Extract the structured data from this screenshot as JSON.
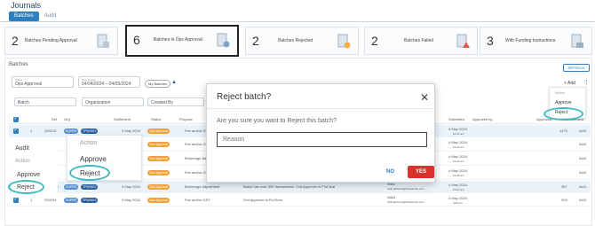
{
  "header": {
    "title": "Journals",
    "tabs": [
      {
        "label": "Batches",
        "active": true
      },
      {
        "label": "Audit",
        "active": false
      }
    ]
  },
  "cards": [
    {
      "count": "2",
      "label": "Batches Pending Approval"
    },
    {
      "count": "6",
      "label": "Batches in Ops Approval"
    },
    {
      "count": "2",
      "label": "Batches Rejected"
    },
    {
      "count": "2",
      "label": "Batches Failed"
    },
    {
      "count": "3",
      "label": "With Funding Instructions"
    }
  ],
  "section": {
    "title": "Batches",
    "refresh": "REFRESH"
  },
  "filters": {
    "status_cap": "Status",
    "status_val": "Ops Approval",
    "date_cap": "Date Range",
    "date_val": "04/04/2024 – 04/05/2024",
    "my_batches": "My Batches",
    "batch_ph": "Batch",
    "org_ph": "Organization",
    "created_ph": "Created By",
    "add": "+ Add"
  },
  "table": {
    "headers": [
      "Ref",
      "Org",
      "Settlement",
      "Status",
      "Purpose",
      "Submitted",
      "Approved by",
      "Approved",
      "Settlement"
    ],
    "rows": [
      {
        "num": "1",
        "ref": "200213",
        "org1": "SUPER",
        "org2": "TPWIDEJ",
        "settle": "4 May 2024",
        "status": "Ops Approval",
        "purpose": "Fee and/or GST",
        "submitted": "4 May 2024",
        "time": "10:23 am",
        "approved": "1475",
        "cur": "AUD"
      },
      {
        "num": "",
        "ref": "",
        "org1": "",
        "org2": "",
        "settle": "4 May 2024",
        "status": "Ops Approval",
        "purpose": "Fee and/or GST",
        "submitted": "4 May 2024",
        "time": "10:23 am",
        "approved": "",
        "cur": "AUD"
      },
      {
        "num": "",
        "ref": "",
        "org1": "",
        "org2": "",
        "settle": "4 May 2024",
        "status": "Ops Approval",
        "purpose": "Brokerage Adjust",
        "submitted": "4 May 2024",
        "time": "10:23 am",
        "approved": "",
        "cur": "AUD"
      },
      {
        "num": "",
        "ref": "",
        "org1": "",
        "org2": "",
        "settle": "4 May 2024",
        "status": "Ops Approval",
        "purpose": "Fee and/or GST",
        "submitted": "4 May 2024",
        "time": "10:45 am",
        "approved": "",
        "cur": "AUD"
      },
      {
        "num": "5",
        "ref": "",
        "org1": "SUPER",
        "org2": "TPWIDEJ",
        "settle": "3 May 2024",
        "status": "Ops Approval",
        "purpose": "Brokerage Adjustment",
        "note": "Batch has over 500 transactions. 2nd Approver is FinClear",
        "user": "Nikki",
        "email": "nikki.gibbons@finclearmfs.com",
        "submitted": "4 May 2024",
        "time": "10:07 am",
        "approved": "357",
        "cur": "AUD"
      },
      {
        "num": "1",
        "ref": "200204",
        "org1": "SUPER",
        "org2": "TPWIDEJ",
        "settle": "3 May 2024",
        "status": "Ops Approval",
        "purpose": "Fee and/or GST",
        "note": "2nd Approver is FinClear",
        "user": "Nikki",
        "email": "nikki.gibbons@finclearmfs.com",
        "submitted": "4 May 2024",
        "time": "4:23 pm",
        "approved": "200",
        "cur": "AUD"
      }
    ]
  },
  "left_panel": {
    "audit": "Audit",
    "action": "Action",
    "approve": "Approve",
    "reject": "Reject"
  },
  "menu_big": {
    "action": "Action",
    "approve": "Approve",
    "reject": "Reject"
  },
  "menu_small": {
    "action": "Action",
    "approve": "Approve",
    "reject": "Reject"
  },
  "modal": {
    "title": "Reject batch?",
    "question": "Are you sure you want to Reject this batch?",
    "reason_ph": "Reason",
    "no": "NO",
    "yes": "YES"
  },
  "colors": {
    "accent": "#2d7fc1",
    "danger": "#d9322d",
    "highlight_ring": "#3fbac2",
    "status": "#f0a23a"
  }
}
